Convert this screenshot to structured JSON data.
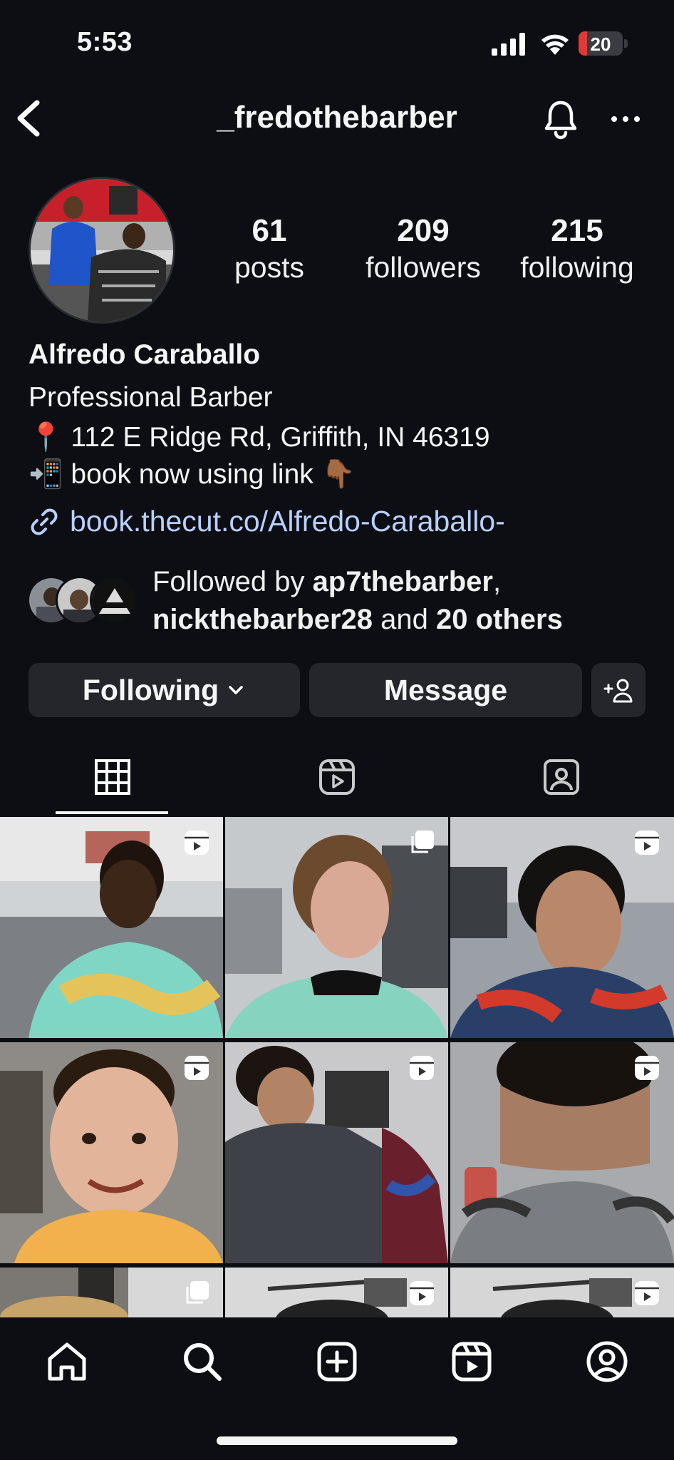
{
  "status_bar": {
    "time": "5:53",
    "battery_level": "20",
    "battery_color": "#e03a36"
  },
  "header": {
    "username": "_fredothebarber",
    "icons": [
      "back-chevron-icon",
      "bell-icon",
      "more-icon"
    ]
  },
  "stats": {
    "posts_count": "61",
    "posts_label": "posts",
    "followers_count": "209",
    "followers_label": "followers",
    "following_count": "215",
    "following_label": "following"
  },
  "bio": {
    "full_name": "Alfredo Caraballo",
    "line1": "Professional Barber",
    "line2": "📍 112 E Ridge Rd, Griffith, IN 46319",
    "line3": "📲 book now using link 👇🏾",
    "link": "book.thecut.co/Alfredo-Caraballo-"
  },
  "followed_by": {
    "prefix": "Followed by ",
    "user1": "ap7thebarber",
    "sep": ",",
    "user2": "nickthebarber28",
    "mid": " and ",
    "others": "20 others"
  },
  "actions": {
    "following_label": "Following",
    "message_label": "Message"
  },
  "tabs": [
    "grid-icon",
    "reels-icon",
    "tagged-icon"
  ],
  "grid_badges": [
    "reel",
    "multi",
    "reel",
    "reel",
    "reel",
    "reel",
    "multi",
    "reel",
    "reel"
  ],
  "bottom_nav": [
    "home-icon",
    "search-icon",
    "create-icon",
    "reels-icon",
    "profile-icon"
  ],
  "colors": {
    "background": "#0c0e13",
    "button": "#24262c",
    "link": "#b9d0ff"
  }
}
